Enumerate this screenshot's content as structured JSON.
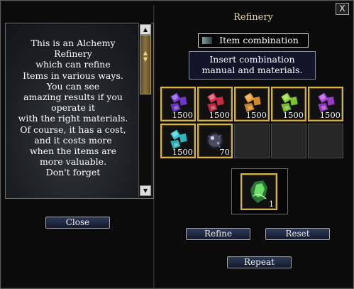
{
  "window": {
    "title": "Refinery",
    "close_glyph": "X"
  },
  "info": {
    "text": "This is an Alchemy\nRefinery\nwhich can refine\nItems in various ways.\nYou can see\namazing results if you\noperate it\nwith the right materials.\nOf course, it has a cost,\nand it costs more\nwhen the items are\nmore valuable.\nDon't forget",
    "scroll_up_icon": "arrow-up-icon",
    "scroll_down_icon": "arrow-down-icon"
  },
  "buttons": {
    "close": "Close",
    "refine": "Refine",
    "reset": "Reset",
    "repeat": "Repeat"
  },
  "combination": {
    "label": "Item combination",
    "instruction": "Insert combination\nmanual and materials."
  },
  "material_slots": [
    {
      "icon": "purple-gem-icon",
      "color": "#7a3ad8",
      "count": "1500"
    },
    {
      "icon": "red-gem-icon",
      "color": "#d8304a",
      "count": "1500"
    },
    {
      "icon": "orange-gem-icon",
      "color": "#e89a2a",
      "count": "1500"
    },
    {
      "icon": "green-gem-icon",
      "color": "#8ad830",
      "count": "1500"
    },
    {
      "icon": "violet-gem-icon",
      "color": "#a840d8",
      "count": "1500"
    },
    {
      "icon": "cyan-gem-icon",
      "color": "#30c8d0",
      "count": "1500"
    },
    {
      "icon": "dark-orb-icon",
      "color": "#4a4a60",
      "count": "70"
    }
  ],
  "result_slot": {
    "icon": "green-crystal-icon",
    "color": "#30a040",
    "count": "1"
  }
}
